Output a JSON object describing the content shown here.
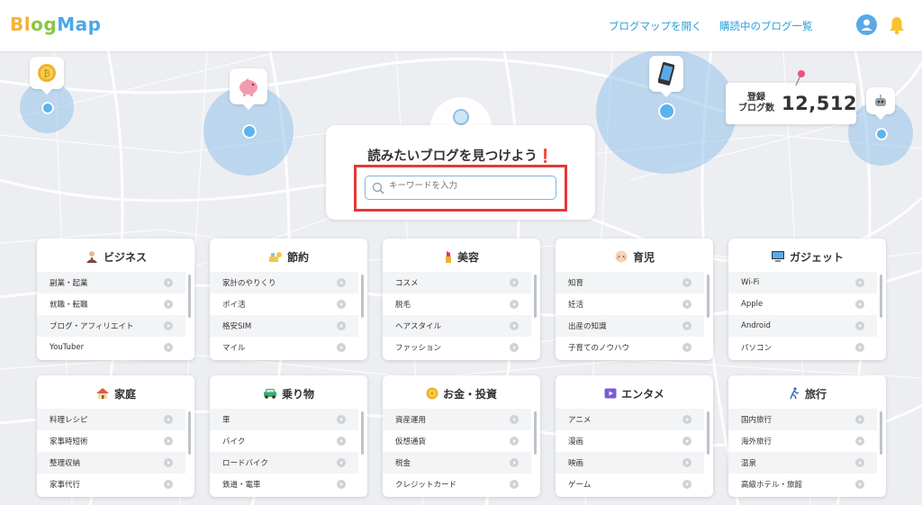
{
  "header": {
    "logo": [
      "B",
      "l",
      "o",
      "g",
      "M",
      "a",
      "p"
    ],
    "logo_colors": [
      "#f5b335",
      "#f5b335",
      "#8cc63f",
      "#8cc63f",
      "#4aa8e8",
      "#4aa8e8",
      "#4aa8e8"
    ],
    "nav_open_map": "ブログマップを開く",
    "nav_subscribed": "購読中のブログ一覧",
    "avatar_icon": "user-icon",
    "bell_icon": "bell-icon"
  },
  "map": {
    "pins": [
      "coin-icon",
      "piggy-bank-icon",
      "smartphone-icon",
      "robot-icon"
    ],
    "circle_color": "#96c3eb"
  },
  "registered": {
    "label_line1": "登録",
    "label_line2": "ブログ数",
    "value": "12,512"
  },
  "search": {
    "title": "読みたいブログを見つけよう",
    "title_mark": "❗",
    "placeholder": "キーワードを入力"
  },
  "categories": [
    {
      "title": "ビジネス",
      "icon": "businessman-icon",
      "items": [
        "副業・起業",
        "就職・転職",
        "ブログ・アフィリエイト",
        "YouTuber"
      ]
    },
    {
      "title": "節約",
      "icon": "saving-icon",
      "items": [
        "家計のやりくり",
        "ポイ活",
        "格安SIM",
        "マイル"
      ]
    },
    {
      "title": "美容",
      "icon": "lipstick-icon",
      "items": [
        "コスメ",
        "脱毛",
        "ヘアスタイル",
        "ファッション"
      ]
    },
    {
      "title": "育児",
      "icon": "baby-icon",
      "items": [
        "知育",
        "妊活",
        "出産の知識",
        "子育てのノウハウ"
      ]
    },
    {
      "title": "ガジェット",
      "icon": "computer-icon",
      "items": [
        "Wi-Fi",
        "Apple",
        "Android",
        "パソコン"
      ]
    },
    {
      "title": "家庭",
      "icon": "house-icon",
      "items": [
        "料理レシピ",
        "家事時短術",
        "整理収納",
        "家事代行"
      ]
    },
    {
      "title": "乗り物",
      "icon": "car-icon",
      "items": [
        "車",
        "バイク",
        "ロードバイク",
        "鉄道・電車"
      ]
    },
    {
      "title": "お金・投資",
      "icon": "coin-icon",
      "items": [
        "資産運用",
        "仮想通貨",
        "税金",
        "クレジットカード"
      ]
    },
    {
      "title": "エンタメ",
      "icon": "play-icon",
      "items": [
        "アニメ",
        "漫画",
        "映画",
        "ゲーム"
      ]
    },
    {
      "title": "旅行",
      "icon": "walking-icon",
      "items": [
        "国内旅行",
        "海外旅行",
        "温泉",
        "高級ホテル・旅館"
      ]
    }
  ]
}
